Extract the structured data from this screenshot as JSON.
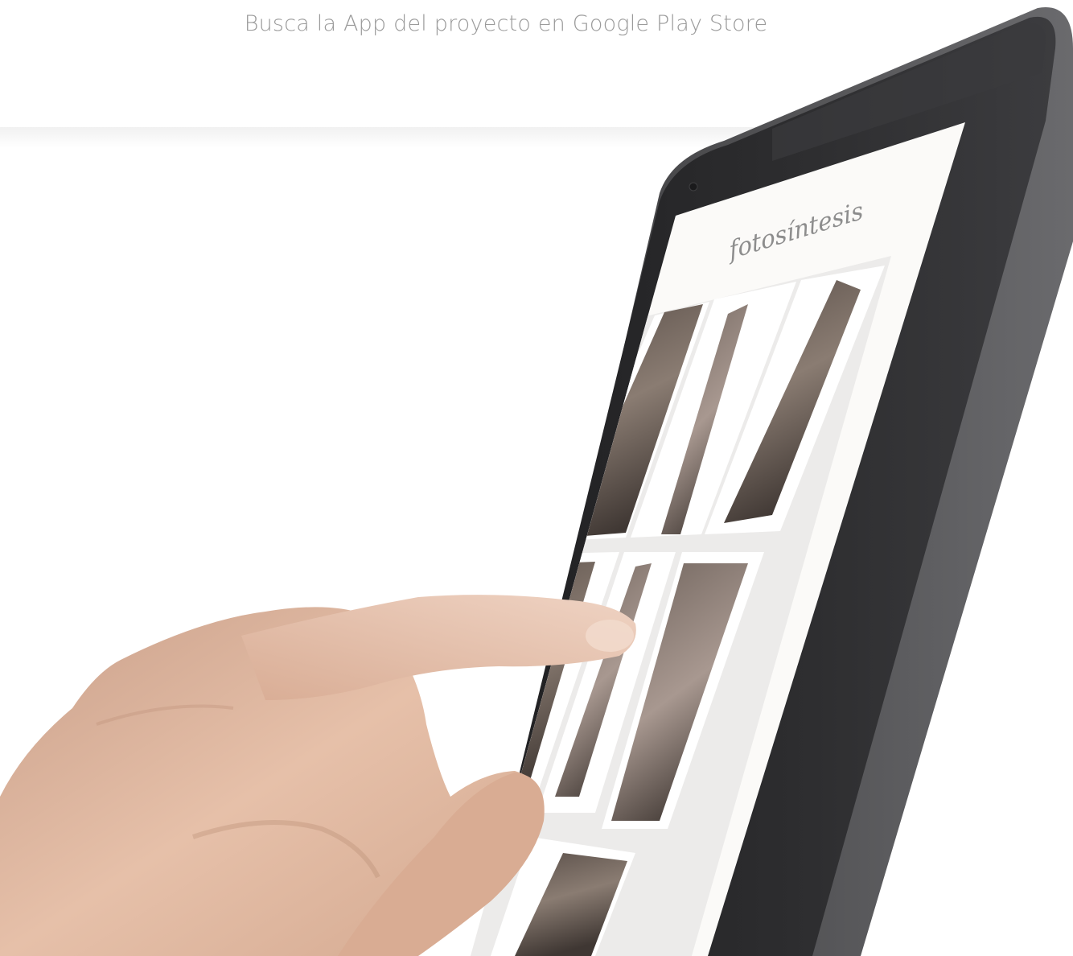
{
  "headline": "Busca la App del proyecto en Google Play Store",
  "app_title": "fotosíntesis",
  "colors": {
    "headline": "#9a9a9a",
    "tablet_body": "#2b2b2d",
    "tablet_edge": "#4a4a4c",
    "screen": "#fbfaf8",
    "skin": "#e0b49a"
  },
  "icons": {
    "camera": "camera-icon"
  }
}
